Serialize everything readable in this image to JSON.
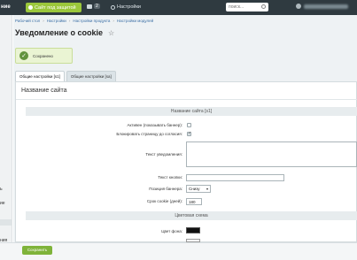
{
  "topbar": {
    "left_fragment": "ние",
    "site_button": "Сайт под защитой",
    "messages_count": "2",
    "settings_label": "Настройки",
    "search_placeholder": "поиск..."
  },
  "sidebar": {
    "frag1": "ь",
    "frag2": "ие",
    "frag3": "ния"
  },
  "breadcrumb": [
    "Рабочий стол",
    "Настройки",
    "Настройки продукта",
    "Настройки модулей"
  ],
  "page_title": "Уведомление о cookie",
  "notice": {
    "text": "Сохранено"
  },
  "tabs": [
    {
      "label": "Общие настройки [s1]",
      "active": true
    },
    {
      "label": "Общие настройки [sa]",
      "active": false
    }
  ],
  "panel": {
    "title": "Название сайта",
    "section1": "Название сайта [s1]",
    "fields": {
      "active_label": "Активен (показывать баннер):",
      "block_label": "Блокировать страницу до согласия:",
      "notice_text_label": "Текст уведомления:",
      "button_text_label": "Текст кнопки:",
      "banner_position_label": "Позиция баннера:",
      "banner_position_value": "Снизу",
      "cookie_days_label": "Срок cookie (дней):",
      "cookie_days_value": "180"
    },
    "section2": "Цветовая схема",
    "bg_color_label": "Цвет фона:"
  },
  "footer": {
    "save_label": "Сохранить"
  },
  "colors": {
    "topbar": "#2f3a40",
    "accent_green": "#7fb33a",
    "notice_bg": "#eaf4d3"
  }
}
